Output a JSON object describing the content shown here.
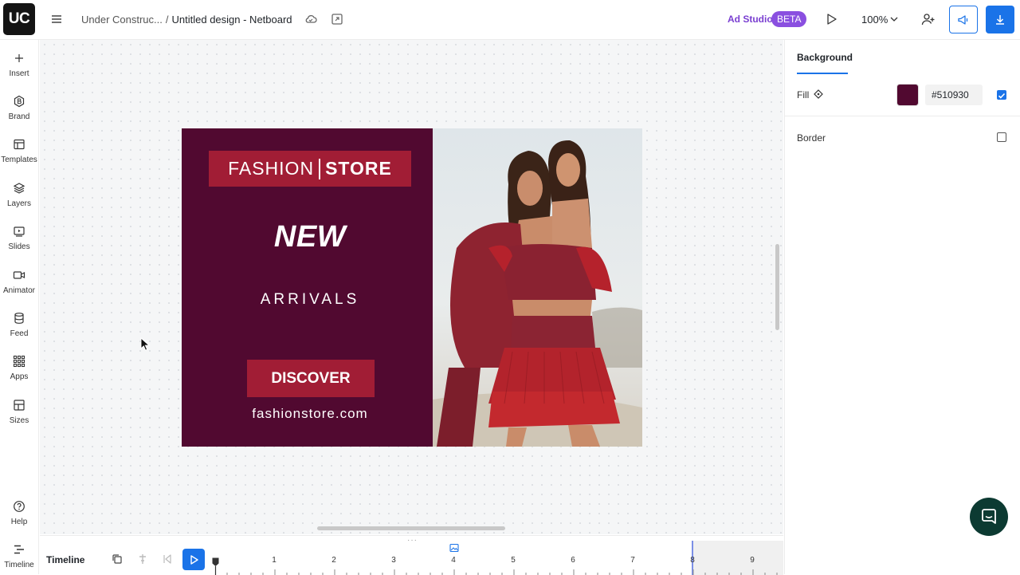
{
  "topbar": {
    "logo": "UC",
    "breadcrumb_parent": "Under Construc...",
    "breadcrumb_sep": "/",
    "document_title": "Untitled design - Netboard",
    "ad_studio_label": "Ad Studio",
    "beta_badge": "BETA",
    "zoom_level": "100%"
  },
  "sidebar": {
    "items": [
      {
        "label": "Insert",
        "icon": "plus-icon"
      },
      {
        "label": "Brand",
        "icon": "brand-icon"
      },
      {
        "label": "Templates",
        "icon": "templates-icon"
      },
      {
        "label": "Layers",
        "icon": "layers-icon"
      },
      {
        "label": "Slides",
        "icon": "slides-icon"
      },
      {
        "label": "Animator",
        "icon": "animator-icon"
      },
      {
        "label": "Feed",
        "icon": "feed-icon"
      },
      {
        "label": "Apps",
        "icon": "apps-icon"
      },
      {
        "label": "Sizes",
        "icon": "sizes-icon"
      }
    ],
    "help_label": "Help",
    "timeline_label": "Timeline"
  },
  "banner": {
    "brand_left": "FASHION",
    "brand_right": "STORE",
    "headline": "NEW",
    "subheadline": "ARRIVALS",
    "cta": "DISCOVER",
    "url": "fashionstore.com",
    "background_color": "#510930",
    "accent_color": "#a11d35"
  },
  "properties": {
    "tab": "Background",
    "fill_label": "Fill",
    "fill_hex": "#510930",
    "fill_enabled": true,
    "border_label": "Border",
    "border_enabled": false
  },
  "timeline": {
    "label": "Timeline",
    "seconds": [
      "1",
      "2",
      "3",
      "4",
      "5",
      "6",
      "7",
      "8",
      "9"
    ]
  },
  "colors": {
    "primary": "#1a73e8",
    "ad_studio": "#7a3fd1",
    "chat_bubble": "#0c3a32"
  }
}
